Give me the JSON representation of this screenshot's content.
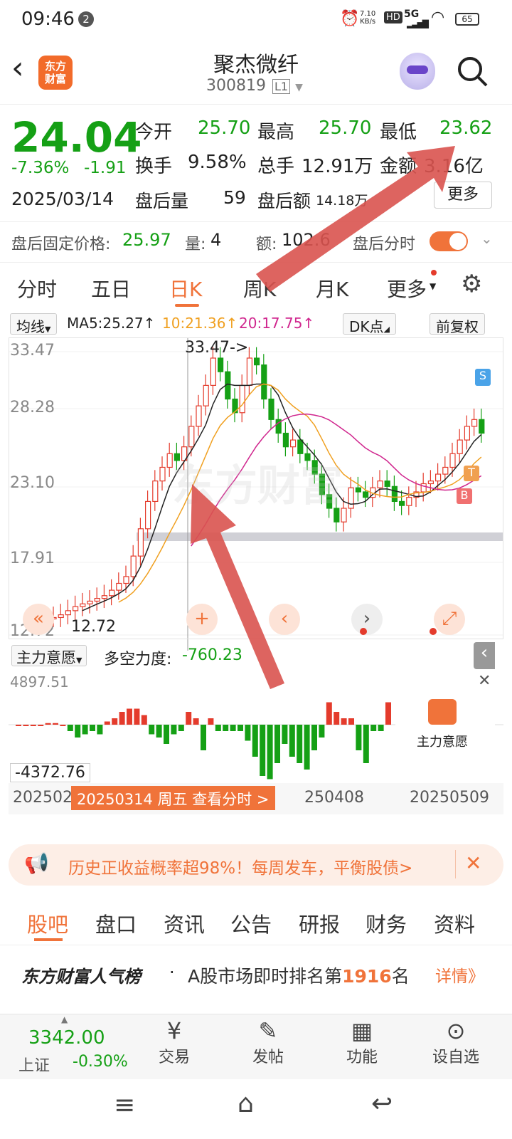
{
  "status": {
    "time": "09:46",
    "notif": "2",
    "speed": "7.10",
    "speed_unit": "KB/s",
    "hd": "HD",
    "net": "5G",
    "battery": "65"
  },
  "header": {
    "title": "聚杰微纤",
    "code": "300819",
    "level": "L1",
    "logo_text": "东方\n财富"
  },
  "quote": {
    "price": "24.04",
    "pct": "-7.36%",
    "chg": "-1.91",
    "date": "2025/03/14",
    "open_label": "今开",
    "open": "25.70",
    "high_label": "最高",
    "high": "25.70",
    "low_label": "最低",
    "low": "23.62",
    "turnover_label": "换手",
    "turnover": "9.58%",
    "vol_label": "总手",
    "vol": "12.91万",
    "amount_label": "金额",
    "amount": "3.16亿",
    "ah_vol_label": "盘后量",
    "ah_vol": "59",
    "ah_amt_label": "盘后额",
    "ah_amt": "14.18万",
    "more": "更多",
    "fixed_label": "盘后固定价格:",
    "fixed_price": "25.97",
    "fixed_qty_label": "量:",
    "fixed_qty": "4",
    "fixed_amt_label": "额:",
    "fixed_amt": "102.6",
    "ah_time_label": "盘后分时"
  },
  "tabs": [
    "分时",
    "五日",
    "日K",
    "周K",
    "月K",
    "更多"
  ],
  "ma": {
    "selector": "均线",
    "ma5": "MA5:25.27↑",
    "ma10": "10:21.36↑",
    "ma20": "20:17.75↑",
    "dk": "DK点",
    "fq": "前复权"
  },
  "chart_axis": {
    "y1": "33.47",
    "y2": "28.28",
    "y3": "23.10",
    "y4": "17.91",
    "y5": "12.72",
    "high_note": "33.47->",
    "low_note": "12.72",
    "watermark": "东方财富"
  },
  "indicator": {
    "selector": "主力意愿",
    "name": "多空力度:",
    "value": "-760.23",
    "ymax": "4897.51",
    "ymin": "-4372.76",
    "panel_label": "主力意愿"
  },
  "dates": {
    "left": "202502",
    "mid": "250408",
    "right": "20250509",
    "tip": "20250314 周五 查看分时 >"
  },
  "marks": {
    "s": "S",
    "t": "T",
    "b": "B"
  },
  "banner": {
    "text": "历史正收益概率超98%！每周发车，平衡股债>"
  },
  "ftabs": [
    "股吧",
    "盘口",
    "资讯",
    "公告",
    "研报",
    "财务",
    "资料"
  ],
  "popular": {
    "brand": "东方财富人气榜",
    "dot": "·",
    "text": "A股市场即时排名第",
    "rank": "1916",
    "suffix": "名",
    "detail": "详情》"
  },
  "bottom": {
    "index_value": "3342.00",
    "index_name": "上证",
    "index_pct": "-0.30%",
    "trade": "交易",
    "post": "发帖",
    "func": "功能",
    "watch": "设自选"
  },
  "colors": {
    "up": "#e43b2c",
    "down": "#15a015",
    "accent": "#f0733a"
  }
}
